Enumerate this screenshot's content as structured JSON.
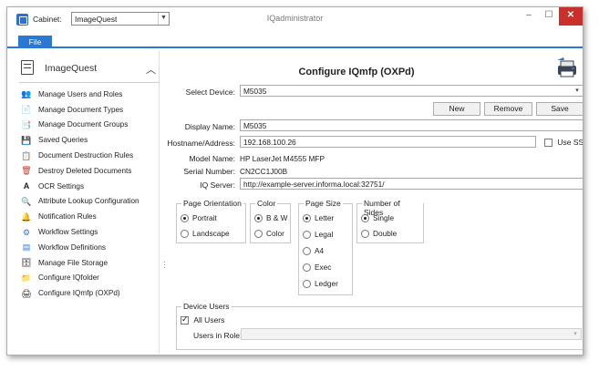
{
  "titlebar": {
    "cabinet_label": "Cabinet:",
    "cabinet_value": "ImageQuest",
    "window_title": "IQadministrator",
    "minimize": "–",
    "maximize": "☐",
    "close": "✕"
  },
  "ribbon": {
    "file_tab": "File"
  },
  "sidebar": {
    "header": "ImageQuest",
    "items": [
      {
        "label": "Manage Users and Roles",
        "icon": "users-icon",
        "glyph": "👥"
      },
      {
        "label": "Manage Document Types",
        "icon": "document-type-icon",
        "glyph": "📄"
      },
      {
        "label": "Manage Document Groups",
        "icon": "document-groups-icon",
        "glyph": "📑"
      },
      {
        "label": "Saved Queries",
        "icon": "saved-queries-icon",
        "glyph": "💾"
      },
      {
        "label": "Document Destruction Rules",
        "icon": "destruction-rules-icon",
        "glyph": "📋"
      },
      {
        "label": "Destroy Deleted Documents",
        "icon": "destroy-documents-icon",
        "glyph": "🗑"
      },
      {
        "label": "OCR Settings",
        "icon": "ocr-icon",
        "glyph": "A"
      },
      {
        "label": "Attribute Lookup Configuration",
        "icon": "lookup-icon",
        "glyph": "🔍"
      },
      {
        "label": "Notification Rules",
        "icon": "notification-icon",
        "glyph": "🔔"
      },
      {
        "label": "Workflow Settings",
        "icon": "workflow-settings-icon",
        "glyph": "⚙"
      },
      {
        "label": "Workflow Definitions",
        "icon": "workflow-definitions-icon",
        "glyph": "▤"
      },
      {
        "label": "Manage File Storage",
        "icon": "file-storage-icon",
        "glyph": "🗄"
      },
      {
        "label": "Configure IQfolder",
        "icon": "iqfolder-icon",
        "glyph": "📁"
      },
      {
        "label": "Configure IQmfp (OXPd)",
        "icon": "iqmfp-icon",
        "glyph": "🖨"
      }
    ]
  },
  "main": {
    "title": "Configure IQmfp (OXPd)",
    "select_device_label": "Select Device:",
    "select_device_value": "M5035",
    "buttons": {
      "new": "New",
      "remove": "Remove",
      "save": "Save"
    },
    "display_name_label": "Display Name:",
    "display_name_value": "M5035",
    "hostname_label": "Hostname/Address:",
    "hostname_value": "192.168.100.26",
    "use_ssl_label": "Use SSL",
    "model_name_label": "Model Name:",
    "model_name_value": "HP LaserJet M4555 MFP",
    "serial_label": "Serial Number:",
    "serial_value": "CN2CC1J00B",
    "iq_server_label": "IQ Server:",
    "iq_server_value": "http://example-server.informa.local:32751/",
    "orientation": {
      "title": "Page Orientation",
      "options": [
        "Portrait",
        "Landscape"
      ],
      "selected": "Portrait"
    },
    "color": {
      "title": "Color",
      "options": [
        "B & W",
        "Color"
      ],
      "selected": "B & W"
    },
    "page_size": {
      "title": "Page Size",
      "options": [
        "Letter",
        "Legal",
        "A4",
        "Exec",
        "Ledger"
      ],
      "selected": "Letter"
    },
    "sides": {
      "title": "Number of Sides",
      "options": [
        "Single",
        "Double"
      ],
      "selected": "Single"
    },
    "device_users": {
      "title": "Device Users",
      "all_users_label": "All Users",
      "users_in_role_label": "Users in Role:",
      "users_in_role_value": ""
    }
  },
  "colors": {
    "accent": "#2b77d4",
    "close": "#c9302c"
  }
}
